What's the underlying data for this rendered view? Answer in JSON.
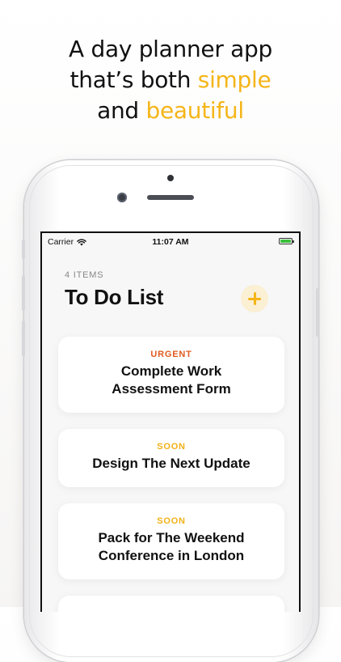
{
  "headline": {
    "line1": "A day planner app",
    "line2_prefix": "that’s both ",
    "line2_accent": "simple",
    "line3_prefix": "and ",
    "line3_accent": "beautiful"
  },
  "status_bar": {
    "carrier": "Carrier",
    "time": "11:07 AM",
    "battery_level": 1.0,
    "wifi_icon": "wifi-icon",
    "battery_icon": "battery-charging-icon"
  },
  "list": {
    "count_label": "4 ITEMS",
    "title": "To Do List",
    "add_icon": "plus-icon"
  },
  "cards": [
    {
      "tag": "URGENT",
      "title_line1": "Complete Work",
      "title_line2": "Assessment Form"
    },
    {
      "tag": "SOON",
      "title_line1": "Design The Next Update",
      "title_line2": ""
    },
    {
      "tag": "SOON",
      "title_line1": "Pack for The Weekend",
      "title_line2": "Conference in London"
    }
  ],
  "colors": {
    "accent": "#f5b518",
    "urgent": "#e05a1e",
    "soon": "#f2b117",
    "battery": "#3bbf3b"
  }
}
